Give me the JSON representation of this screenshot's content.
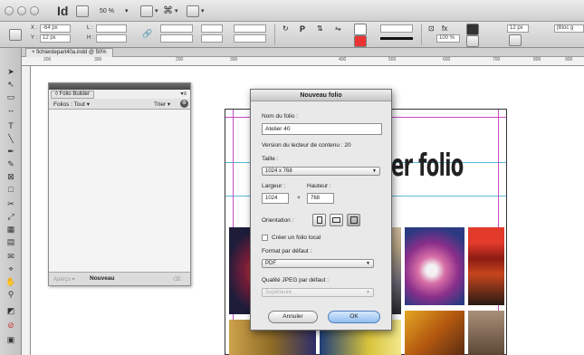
{
  "appbar": {
    "logo": "Id",
    "zoom": "50 %"
  },
  "controlbar": {
    "x_label": "X :",
    "x_value": "-64 px",
    "y_label": "Y :",
    "y_value": "12 px",
    "l_label": "L :",
    "h_label": "H :",
    "stroke_width": "",
    "opacity": "100 %",
    "frame_size": "12 px",
    "style_field": "[Bloc g"
  },
  "document": {
    "tab_label": "fichierdepart40a.indd @ 50%",
    "ruler_ticks": [
      "200",
      "300",
      "200",
      "300",
      "400",
      "500",
      "600",
      "700",
      "800",
      "900"
    ],
    "heading": "er folio"
  },
  "folio_panel": {
    "tab_label": "Folio Builder",
    "filter_label": "Folios : Tout",
    "sort_label": "Trier",
    "footer_left": "Aperçu",
    "footer_new": "Nouveau"
  },
  "dialog": {
    "title": "Nouveau folio",
    "name_label": "Nom du folio :",
    "name_value": "Atelier 40",
    "viewer_version": "Version du lecteur de contenu : 20",
    "size_label": "Taille :",
    "size_value": "1024 x 768",
    "width_label": "Largeur :",
    "width_value": "1024",
    "times": "×",
    "height_label": "Hauteur :",
    "height_value": "768",
    "orientation_label": "Orientation :",
    "local_folio_label": "Créer un folio local",
    "format_label": "Format par défaut :",
    "format_value": "PDF",
    "jpeg_label": "Qualité JPEG par défaut :",
    "jpeg_value": "Supérieure",
    "cancel_label": "Annuler",
    "ok_label": "OK"
  }
}
